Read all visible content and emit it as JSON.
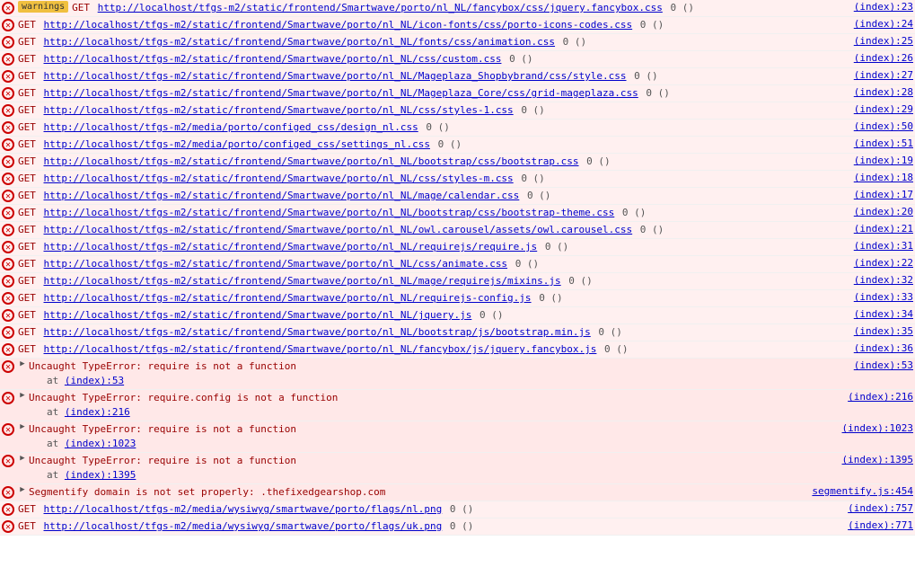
{
  "console": {
    "rows": [
      {
        "type": "get-error",
        "url": "http://localhost/tfgs-m2/static/frontend/Smartwave/porto/nl_NL/fancybox/css/jquery.fancybox.css",
        "suffix": "0 ()",
        "source": "(index):23",
        "badge": "warnings"
      },
      {
        "type": "get-error",
        "url": "http://localhost/tfgs-m2/static/frontend/Smartwave/porto/nl_NL/icon-fonts/css/porto-icons-codes.css",
        "suffix": "0 ()",
        "source": "(index):24"
      },
      {
        "type": "get-error",
        "url": "http://localhost/tfgs-m2/static/frontend/Smartwave/porto/nl_NL/fonts/css/animation.css",
        "suffix": "0 ()",
        "source": "(index):25"
      },
      {
        "type": "get-error",
        "url": "http://localhost/tfgs-m2/static/frontend/Smartwave/porto/nl_NL/css/custom.css",
        "suffix": "0 ()",
        "source": "(index):26"
      },
      {
        "type": "get-error",
        "url": "http://localhost/tfgs-m2/static/frontend/Smartwave/porto/nl_NL/Mageplaza_Shopbybrand/css/style.css",
        "suffix": "0 ()",
        "source": "(index):27"
      },
      {
        "type": "get-error",
        "url": "http://localhost/tfgs-m2/static/frontend/Smartwave/porto/nl_NL/Mageplaza_Core/css/grid-mageplaza.css",
        "suffix": "0 ()",
        "source": "(index):28"
      },
      {
        "type": "get-error",
        "url": "http://localhost/tfgs-m2/static/frontend/Smartwave/porto/nl_NL/css/styles-1.css",
        "suffix": "0 ()",
        "source": "(index):29"
      },
      {
        "type": "get-error",
        "url": "http://localhost/tfgs-m2/media/porto/configed_css/design_nl.css",
        "suffix": "0 ()",
        "source": "(index):50"
      },
      {
        "type": "get-error",
        "url": "http://localhost/tfgs-m2/media/porto/configed_css/settings_nl.css",
        "suffix": "0 ()",
        "source": "(index):51"
      },
      {
        "type": "get-error",
        "url": "http://localhost/tfgs-m2/static/frontend/Smartwave/porto/nl_NL/bootstrap/css/bootstrap.css",
        "suffix": "0 ()",
        "source": "(index):19"
      },
      {
        "type": "get-error",
        "url": "http://localhost/tfgs-m2/static/frontend/Smartwave/porto/nl_NL/css/styles-m.css",
        "suffix": "0 ()",
        "source": "(index):18"
      },
      {
        "type": "get-error",
        "url": "http://localhost/tfgs-m2/static/frontend/Smartwave/porto/nl_NL/mage/calendar.css",
        "suffix": "0 ()",
        "source": "(index):17"
      },
      {
        "type": "get-error",
        "url": "http://localhost/tfgs-m2/static/frontend/Smartwave/porto/nl_NL/bootstrap/css/bootstrap-theme.css",
        "suffix": "0 ()",
        "source": "(index):20"
      },
      {
        "type": "get-error",
        "url": "http://localhost/tfgs-m2/static/frontend/Smartwave/porto/nl_NL/owl.carousel/assets/owl.carousel.css",
        "suffix": "0 ()",
        "source": "(index):21"
      },
      {
        "type": "get-error",
        "url": "http://localhost/tfgs-m2/static/frontend/Smartwave/porto/nl_NL/requirejs/require.js",
        "suffix": "0 ()",
        "source": "(index):31"
      },
      {
        "type": "get-error",
        "url": "http://localhost/tfgs-m2/static/frontend/Smartwave/porto/nl_NL/css/animate.css",
        "suffix": "0 ()",
        "source": "(index):22"
      },
      {
        "type": "get-error",
        "url": "http://localhost/tfgs-m2/static/frontend/Smartwave/porto/nl_NL/mage/requirejs/mixins.js",
        "suffix": "0 ()",
        "source": "(index):32"
      },
      {
        "type": "get-error",
        "url": "http://localhost/tfgs-m2/static/frontend/Smartwave/porto/nl_NL/requirejs-config.js",
        "suffix": "0 ()",
        "source": "(index):33"
      },
      {
        "type": "get-error",
        "url": "http://localhost/tfgs-m2/static/frontend/Smartwave/porto/nl_NL/jquery.js",
        "suffix": "0 ()",
        "source": "(index):34"
      },
      {
        "type": "get-error",
        "url": "http://localhost/tfgs-m2/static/frontend/Smartwave/porto/nl_NL/bootstrap/js/bootstrap.min.js",
        "suffix": "0 ()",
        "source": "(index):35"
      },
      {
        "type": "get-error",
        "url": "http://localhost/tfgs-m2/static/frontend/Smartwave/porto/nl_NL/fancybox/js/jquery.fancybox.js",
        "suffix": "0 ()",
        "source": "(index):36"
      },
      {
        "type": "uncaught",
        "expandable": true,
        "main": "Uncaught TypeError: require is not a function",
        "sub": "at (index):53",
        "source": "(index):53"
      },
      {
        "type": "uncaught",
        "expandable": true,
        "main": "Uncaught TypeError: require.config is not a function",
        "sub": "at (index):216",
        "source": "(index):216"
      },
      {
        "type": "uncaught",
        "expandable": true,
        "main": "Uncaught TypeError: require is not a function",
        "sub": "at (index):1023",
        "source": "(index):1023"
      },
      {
        "type": "uncaught",
        "expandable": true,
        "main": "Uncaught TypeError: require is not a function",
        "sub": "at (index):1395",
        "source": "(index):1395"
      },
      {
        "type": "uncaught",
        "expandable": true,
        "main": "Segmentify domain is not set properly: .thefixedgearshop.com",
        "sub": null,
        "source": "segmentify.js:454"
      },
      {
        "type": "get-error",
        "url": "http://localhost/tfgs-m2/media/wysiwyg/smartwave/porto/flags/nl.png",
        "suffix": "0 ()",
        "source": "(index):757"
      },
      {
        "type": "get-error",
        "url": "http://localhost/tfgs-m2/media/wysiwyg/smartwave/porto/flags/uk.png",
        "suffix": "0 ()",
        "source": "(index):771"
      }
    ]
  }
}
